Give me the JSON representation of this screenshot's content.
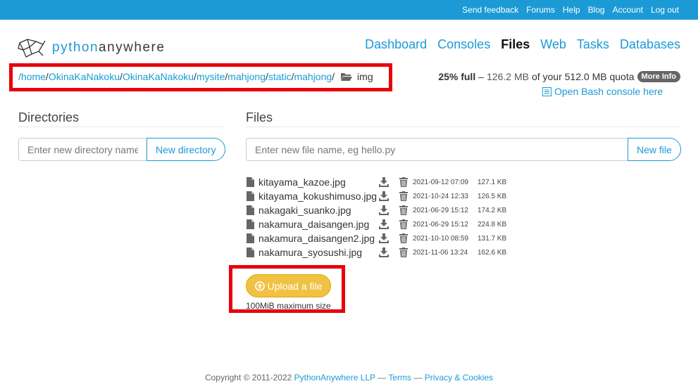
{
  "topbar": {
    "links": [
      "Send feedback",
      "Forums",
      "Help",
      "Blog",
      "Account",
      "Log out"
    ]
  },
  "logo": {
    "part1": "python",
    "part2": "anywhere"
  },
  "nav": {
    "items": [
      "Dashboard",
      "Consoles",
      "Files",
      "Web",
      "Tasks",
      "Databases"
    ],
    "active": "Files"
  },
  "breadcrumb": {
    "crumbs": [
      "/home",
      "OkinaKaNakoku",
      "OkinaKaNakoku",
      "mysite",
      "mahjong",
      "static",
      "mahjong"
    ],
    "separator": "/",
    "current": "img"
  },
  "quota": {
    "percent": "25% full",
    "dash": "–",
    "used": "126.2 MB",
    "of_text": "of your 512.0 MB quota",
    "more_info": "More Info"
  },
  "bash_link": "Open Bash console here",
  "directories": {
    "title": "Directories",
    "placeholder": "Enter new directory name",
    "button": "New directory"
  },
  "files": {
    "title": "Files",
    "placeholder": "Enter new file name, eg hello.py",
    "button": "New file",
    "list": [
      {
        "name": "kitayama_kazoe.jpg",
        "date": "2021-09-12 07:09",
        "size": "127.1 KB"
      },
      {
        "name": "kitayama_kokushimuso.jpg",
        "date": "2021-10-24 12:33",
        "size": "126.5 KB"
      },
      {
        "name": "nakagaki_suanko.jpg",
        "date": "2021-06-29 15:12",
        "size": "174.2 KB"
      },
      {
        "name": "nakamura_daisangen.jpg",
        "date": "2021-06-29 15:12",
        "size": "224.8 KB"
      },
      {
        "name": "nakamura_daisangen2.jpg",
        "date": "2021-10-10 08:59",
        "size": "131.7 KB"
      },
      {
        "name": "nakamura_syosushi.jpg",
        "date": "2021-11-06 13:24",
        "size": "162.6 KB"
      }
    ]
  },
  "upload": {
    "button": "Upload a file",
    "max_size": "100MiB maximum size"
  },
  "footer": {
    "copyright": "Copyright © 2011-2022",
    "company": "PythonAnywhere LLP",
    "dash1": "—",
    "terms": "Terms",
    "dash2": "—",
    "privacy": "Privacy & Cookies"
  },
  "colors": {
    "brand_blue": "#1b9ad6",
    "highlight_red": "#e8000b",
    "upload_yellow": "#f0c143"
  }
}
